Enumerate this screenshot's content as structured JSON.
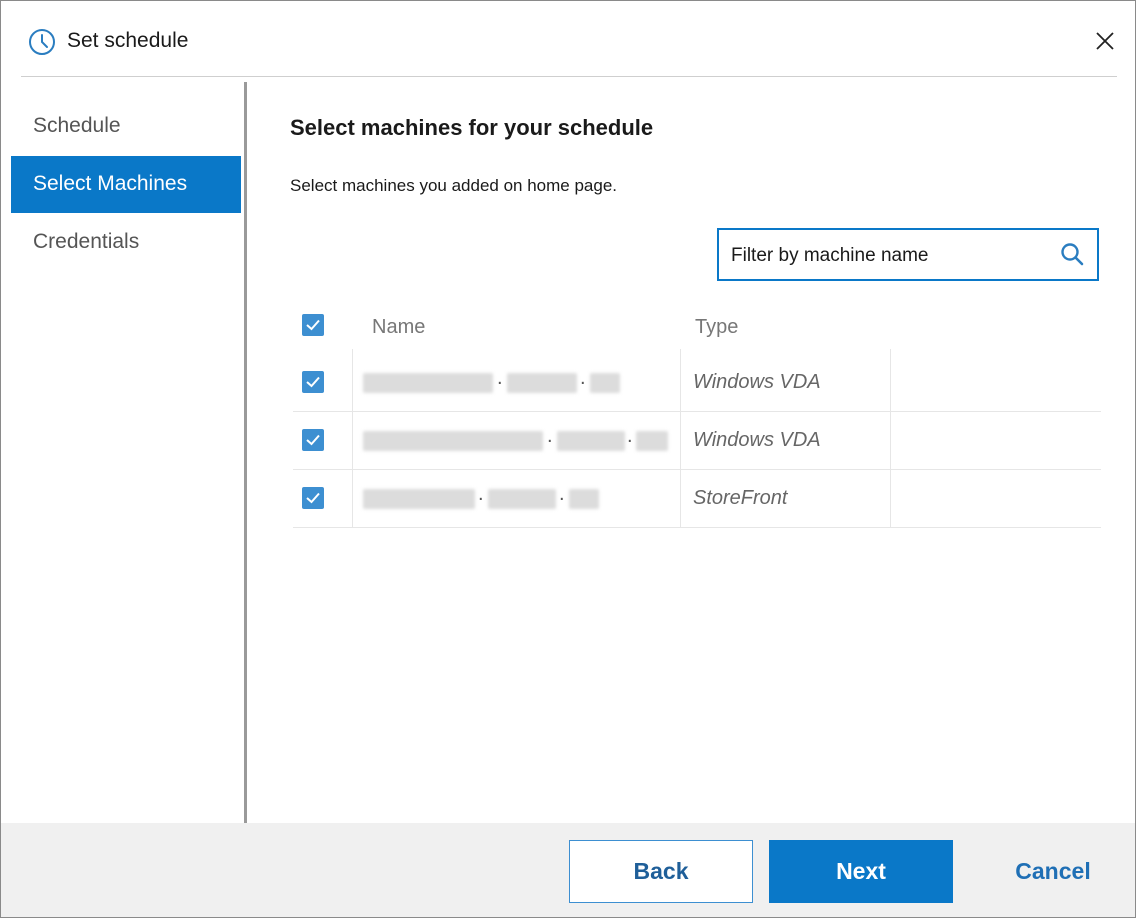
{
  "window": {
    "title": "Set schedule",
    "title_icon": "clock-icon",
    "close_icon": "close-icon"
  },
  "sidebar": {
    "items": [
      {
        "label": "Schedule",
        "active": false
      },
      {
        "label": "Select Machines",
        "active": true
      },
      {
        "label": "Credentials",
        "active": false
      }
    ]
  },
  "main": {
    "heading": "Select machines for your schedule",
    "subtitle": "Select machines you added on home page.",
    "filter": {
      "placeholder": "Filter by machine name",
      "value": "",
      "icon": "search-icon"
    },
    "table": {
      "select_all_checked": true,
      "columns": [
        "Name",
        "Type"
      ],
      "rows": [
        {
          "checked": true,
          "name": "(redacted)",
          "type": "Windows VDA"
        },
        {
          "checked": true,
          "name": "(redacted)",
          "type": "Windows VDA"
        },
        {
          "checked": true,
          "name": "(redacted)",
          "type": "StoreFront"
        }
      ]
    }
  },
  "footer": {
    "back_label": "Back",
    "next_label": "Next",
    "cancel_label": "Cancel"
  },
  "colors": {
    "accent": "#0a78c8",
    "checkbox": "#3d8fd1",
    "footer_bg": "#f0f0f0"
  }
}
